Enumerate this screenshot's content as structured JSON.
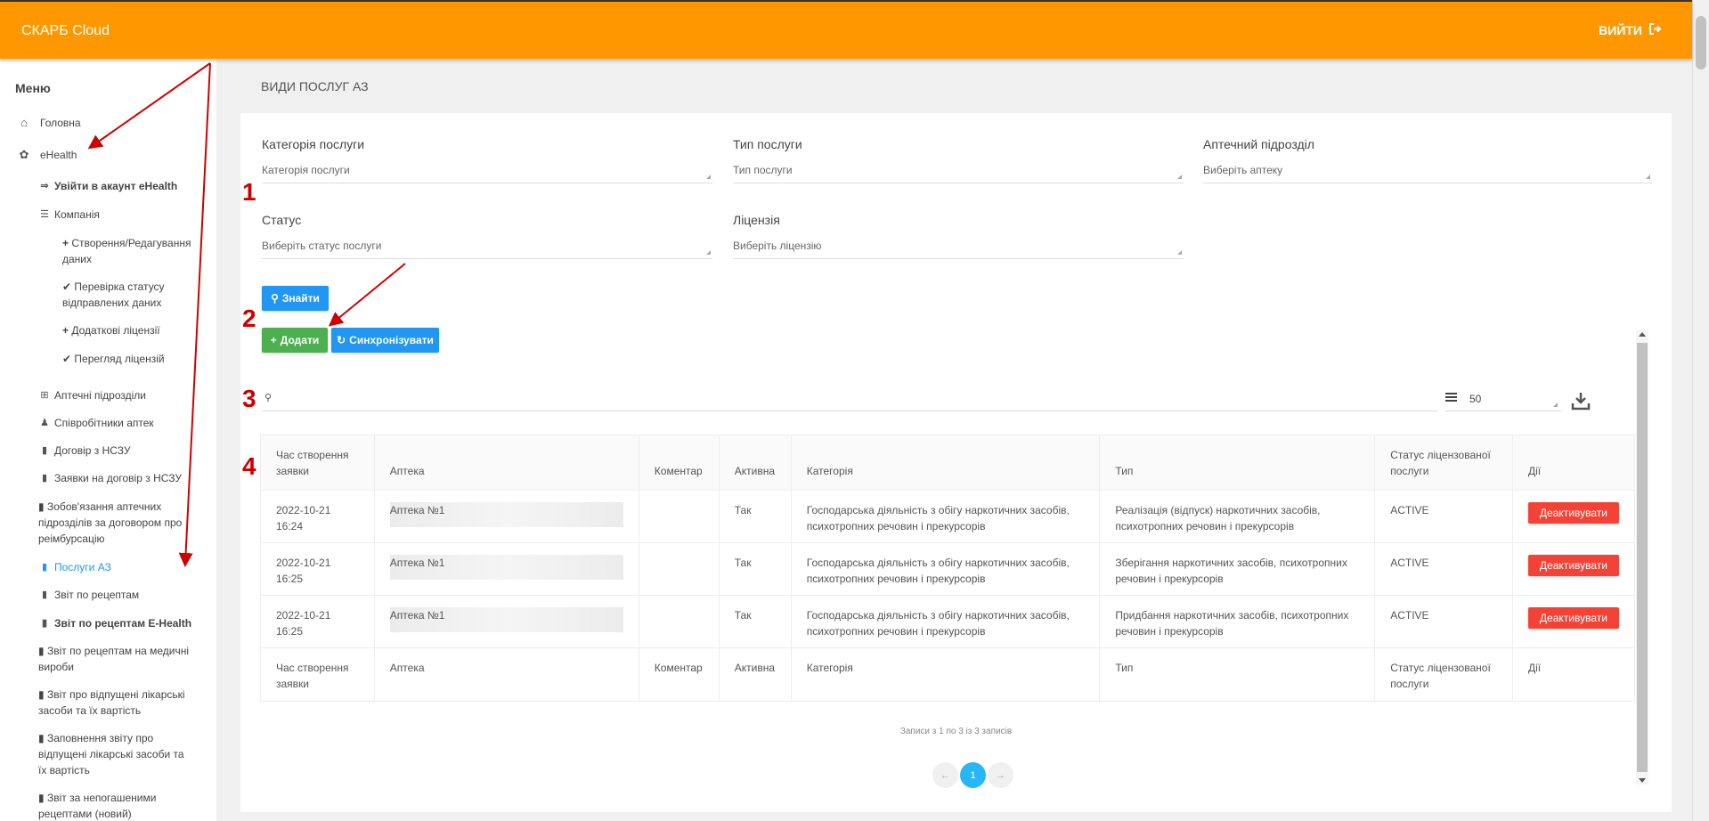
{
  "app": {
    "brand": "СКАРБ Cloud",
    "logout_label": "ВИЙТИ"
  },
  "sidebar": {
    "title": "Меню",
    "items": [
      {
        "label": "Головна",
        "icon": "home-icon"
      },
      {
        "label": "eHealth",
        "icon": "leaf-icon"
      },
      {
        "label": "Увійти в акаунт eHealth",
        "icon": "sign-in-icon"
      },
      {
        "label": "Компанія",
        "icon": "database-icon"
      },
      {
        "label": "Створення/Редагування даних",
        "icon": "plus-icon"
      },
      {
        "label": "Перевірка статусу відправлених даних",
        "icon": "check-icon"
      },
      {
        "label": "Додаткові ліцензії",
        "icon": "plus-icon"
      },
      {
        "label": "Перегляд ліцензій",
        "icon": "check-icon"
      },
      {
        "label": "Аптечні підрозділи",
        "icon": "plus-square-icon"
      },
      {
        "label": "Співробітники аптек",
        "icon": "user-icon"
      },
      {
        "label": "Договір з НСЗУ",
        "icon": "file-icon"
      },
      {
        "label": "Заявки на договір з НСЗУ",
        "icon": "file-icon"
      },
      {
        "label": "Зобов'язання аптечних підрозділів за договором про реімбурсацію",
        "icon": "file-icon"
      },
      {
        "label": "Послуги АЗ",
        "icon": "file-icon"
      },
      {
        "label": "Звіт по рецептам",
        "icon": "file-icon"
      },
      {
        "label": "Звіт по рецептам E-Health",
        "icon": "file-icon"
      },
      {
        "label": "Звіт по рецептам на медичні вироби",
        "icon": "file-icon"
      },
      {
        "label": "Звіт про відпущені лікарські засоби та їх вартість",
        "icon": "file-icon"
      },
      {
        "label": "Заповнення звіту про відпущені лікарські засоби та їх вартість",
        "icon": "file-icon"
      },
      {
        "label": "Звіт за непогашеними рецептами (новий)",
        "icon": "file-icon"
      }
    ]
  },
  "page": {
    "title": "ВИДИ ПОСЛУГ АЗ"
  },
  "filters": {
    "category": {
      "label": "Категорія послуги",
      "placeholder": "Категорія послуги"
    },
    "type": {
      "label": "Тип послуги",
      "placeholder": "Тип послуги"
    },
    "pharmacy": {
      "label": "Аптечний підрозділ",
      "placeholder": "Виберіть аптеку"
    },
    "status": {
      "label": "Статус",
      "placeholder": "Виберіть статус послуги"
    },
    "license": {
      "label": "Ліцензія",
      "placeholder": "Виберіть ліцензію"
    }
  },
  "buttons": {
    "find": "Знайти",
    "add": "Додати",
    "sync": "Синхронізувати",
    "deactivate": "Деактивувати"
  },
  "table": {
    "page_size": "50",
    "columns": [
      "Час створення заявки",
      "Аптека",
      "Коментар",
      "Активна",
      "Категорія",
      "Тип",
      "Статус ліцензованої послуги",
      "Дії"
    ],
    "rows": [
      {
        "time": "2022-10-21 16:24",
        "apteka": "Аптека №1",
        "comment": "",
        "active": "Так",
        "category": "Господарська діяльність з обігу наркотичних засобів, психотропних речовин і прекурсорів",
        "type": "Реалізація (відпуск) наркотичних засобів, психотропних речовин і прекурсорів",
        "status": "ACTIVE"
      },
      {
        "time": "2022-10-21 16:25",
        "apteka": "Аптека №1",
        "comment": "",
        "active": "Так",
        "category": "Господарська діяльність з обігу наркотичних засобів, психотропних речовин і прекурсорів",
        "type": "Зберігання наркотичних засобів, психотропних речовин і прекурсорів",
        "status": "ACTIVE"
      },
      {
        "time": "2022-10-21 16:25",
        "apteka": "Аптека №1",
        "comment": "",
        "active": "Так",
        "category": "Господарська діяльність з обігу наркотичних засобів, психотропних речовин і прекурсорів",
        "type": "Придбання наркотичних засобів, психотропних речовин і прекурсорів",
        "status": "ACTIVE"
      }
    ],
    "records_info": "Записи з 1 по 3 із 3 записів"
  },
  "pagination": {
    "prev": "←",
    "current": "1",
    "next": "→"
  },
  "annotations": [
    "1",
    "2",
    "3",
    "4"
  ],
  "colors": {
    "header": "#ff9800",
    "primary": "#2196f3",
    "success": "#4caf50",
    "danger": "#f44336",
    "annotation": "#cc0000"
  }
}
